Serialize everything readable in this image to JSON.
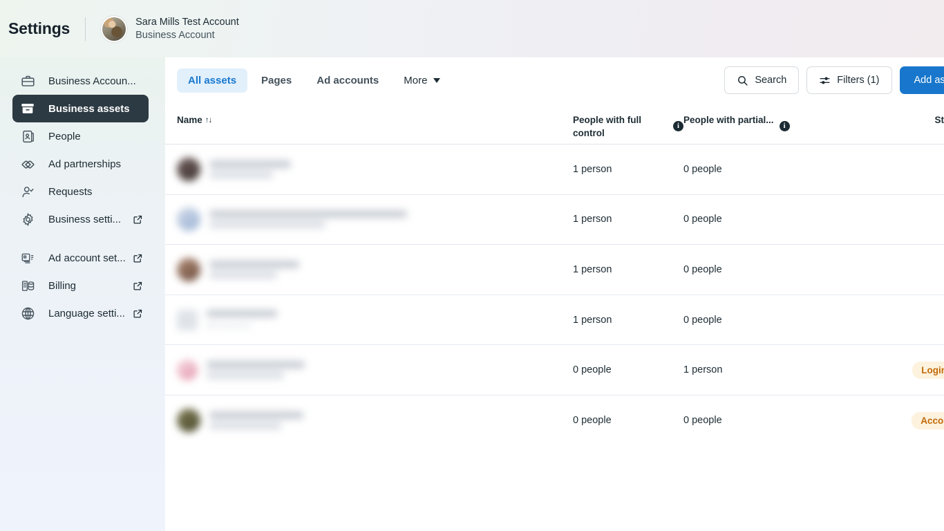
{
  "header": {
    "title": "Settings",
    "account_name": "Sara Mills Test Account",
    "account_type": "Business Account"
  },
  "sidebar": {
    "items": [
      {
        "label": "Business Accoun...",
        "icon": "briefcase-icon",
        "external": false,
        "active": false
      },
      {
        "label": "Business assets",
        "icon": "archive-box-icon",
        "external": false,
        "active": true
      },
      {
        "label": "People",
        "icon": "id-card-icon",
        "external": false,
        "active": false
      },
      {
        "label": "Ad partnerships",
        "icon": "handshake-icon",
        "external": false,
        "active": false
      },
      {
        "label": "Requests",
        "icon": "person-check-icon",
        "external": false,
        "active": false
      },
      {
        "label": "Business setti...",
        "icon": "gear-icon",
        "external": true,
        "active": false
      },
      {
        "label": "Ad account set...",
        "icon": "ad-account-icon",
        "external": true,
        "active": false
      },
      {
        "label": "Billing",
        "icon": "billing-stack-icon",
        "external": true,
        "active": false
      },
      {
        "label": "Language setti...",
        "icon": "globe-icon",
        "external": true,
        "active": false
      }
    ]
  },
  "toolbar": {
    "tabs": [
      {
        "label": "All assets",
        "active": true
      },
      {
        "label": "Pages",
        "active": false
      },
      {
        "label": "Ad accounts",
        "active": false
      }
    ],
    "more_label": "More",
    "search_label": "Search",
    "filters_label": "Filters (1)",
    "add_asset_label": "Add asset"
  },
  "table": {
    "headers": {
      "name": "Name",
      "sort_glyph": "↑↓",
      "full_control": "People with full control",
      "partial": "People with partial...",
      "status": "St"
    },
    "rows": [
      {
        "name_redacted": true,
        "thumb": "avatar-dark",
        "subtitle": "",
        "full_control": "1 person",
        "partial": "0 people",
        "status": ""
      },
      {
        "name_redacted": true,
        "thumb": "avatar-blue",
        "subtitle": "",
        "full_control": "1 person",
        "partial": "0 people",
        "status": ""
      },
      {
        "name_redacted": true,
        "thumb": "avatar-brown",
        "subtitle": "",
        "full_control": "1 person",
        "partial": "0 people",
        "status": ""
      },
      {
        "name_redacted": true,
        "thumb": "square-ad",
        "subtitle": "Ad account",
        "full_control": "1 person",
        "partial": "0 people",
        "status": ""
      },
      {
        "name_redacted": true,
        "thumb": "avatar-pink",
        "subtitle": "",
        "full_control": "0 people",
        "partial": "1 person",
        "status": "Login nee"
      },
      {
        "name_redacted": true,
        "thumb": "avatar-olive",
        "subtitle": "",
        "full_control": "0 people",
        "partial": "0 people",
        "status": "Account switch requ"
      }
    ]
  },
  "colors": {
    "accent_blue": "#1877cc",
    "tab_active_text": "#1878d0",
    "tab_active_bg": "#e2f0fc",
    "sidebar_active_bg": "#2c3a43",
    "badge_text": "#c26a09",
    "badge_bg": "#fdf2dd"
  }
}
